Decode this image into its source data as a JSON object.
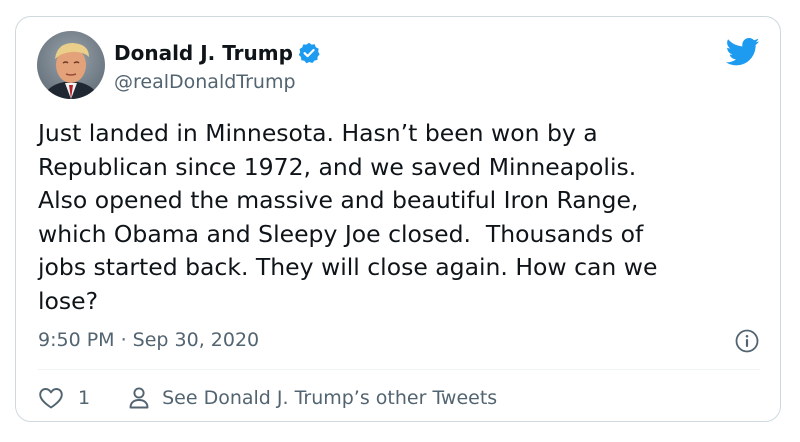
{
  "colors": {
    "text_primary": "#0f1419",
    "text_secondary": "#536471",
    "verified_blue": "#1d9bf0",
    "twitter_blue": "#1d9bf0",
    "border": "#cfd9de"
  },
  "author": {
    "display_name": "Donald J. Trump",
    "handle": "@realDonaldTrump",
    "verified": true,
    "avatar_icon": "profile-photo"
  },
  "brand_icon": "twitter-bird-icon",
  "tweet": {
    "text": "Just landed in Minnesota. Hasn’t been won by a\nRepublican since 1972, and we saved Minneapolis.\nAlso opened the massive and beautiful Iron Range,\nwhich Obama and Sleepy Joe closed.  Thousands of\njobs started back. They will close again. How can we\nlose?",
    "timestamp": "9:50 PM · Sep 30, 2020"
  },
  "actions": {
    "like_count": "1",
    "profile_link_label": "See Donald J. Trump’s other Tweets"
  }
}
